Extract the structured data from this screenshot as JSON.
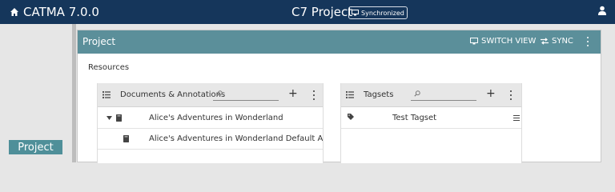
{
  "topbar": {
    "app_name": "CATMA 7.0.0",
    "project_title": "C7 Project",
    "sync_status": "Synchronized"
  },
  "leftnav": {
    "project_label": "Project"
  },
  "card": {
    "title": "Project",
    "switch_view_label": "SWITCH VIEW",
    "sync_label": "SYNC",
    "resources_label": "Resources"
  },
  "documents_panel": {
    "title": "Documents & Annotations",
    "search_value": "",
    "rows": [
      {
        "text": "Alice's Adventures in Wonderland"
      },
      {
        "text": "Alice's Adventures in Wonderland Default Annotations"
      }
    ]
  },
  "tagsets_panel": {
    "title": "Tagsets",
    "search_value": "",
    "rows": [
      {
        "text": "Test Tagset"
      }
    ]
  },
  "colors": {
    "topbar": "#15365b",
    "card_header": "#5b8f9a",
    "nav_selected": "#4f8f99"
  },
  "icons": [
    "home-icon",
    "monitor-icon",
    "user-icon",
    "list-icon",
    "search-icon",
    "plus-icon",
    "more-vert-icon",
    "caret-down-icon",
    "document-icon",
    "tags-icon",
    "hamburger-icon",
    "swap-icon"
  ]
}
